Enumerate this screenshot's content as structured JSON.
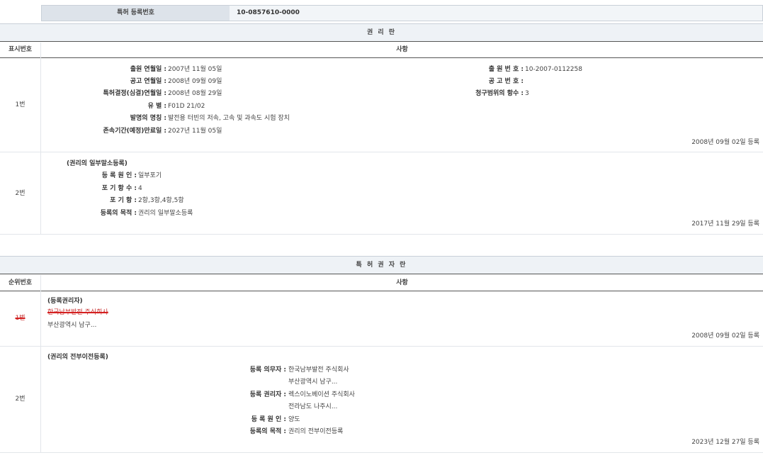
{
  "header": {
    "reg_label": "특허 등록번호",
    "reg_value": "10-0857610-0000"
  },
  "rights": {
    "title": "권 리 란",
    "col_num": "표시번호",
    "col_item": "사항",
    "row1": {
      "num": "1번",
      "left": [
        {
          "k": "출원 연월일 :",
          "v": "2007년 11월 05일"
        },
        {
          "k": "공고 연월일 :",
          "v": "2008년 09월 09일"
        },
        {
          "k": "특허결정(심결)연월일 :",
          "v": "2008년 08월 29일"
        },
        {
          "k": "유 별 :",
          "v": "F01D 21/02"
        },
        {
          "k": "발명의 명칭 :",
          "v": "발전용 터빈의 저속, 고속 및 과속도 시험 장치"
        },
        {
          "k": "존속기간(예정)만료일 :",
          "v": "2027년 11월 05일"
        }
      ],
      "right": [
        {
          "k": "출 원 번 호 :",
          "v": "10-2007-0112258"
        },
        {
          "k": "공 고 번 호 :",
          "v": ""
        },
        {
          "k": "청구범위의 항수 :",
          "v": "3"
        }
      ],
      "date": "2008년 09월 02일 등록"
    },
    "row2": {
      "num": "2번",
      "heading": "(권리의 일부말소등록)",
      "fields": [
        {
          "k": "등 록 원 인 :",
          "v": "일부포기"
        },
        {
          "k": "포 기 항 수 :",
          "v": "4"
        },
        {
          "k": "포 기 항 :",
          "v": "2항,3항,4항,5항"
        },
        {
          "k": "등록의 목적 :",
          "v": "권리의 일부말소등록"
        }
      ],
      "date": "2017년 11월 29일 등록"
    }
  },
  "holders": {
    "title": "특 허 권 자 란",
    "col_num": "순위번호",
    "col_item": "사항",
    "row1": {
      "num": "1번",
      "heading": "(등록권리자)",
      "name": "한국남부발전 주식회사",
      "addr": "부산광역시 남구...",
      "date": "2008년 09월 02일 등록"
    },
    "row2": {
      "num": "2번",
      "heading": "(권리의 전부이전등록)",
      "fields": [
        {
          "k": "등록 의무자 :",
          "v": "한국남부발전 주식회사"
        },
        {
          "k": "",
          "v": "부산광역시 남구..."
        },
        {
          "k": "등록 권리자 :",
          "v": "렉스이노베이션 주식회사"
        },
        {
          "k": "",
          "v": "전라남도 나주시..."
        },
        {
          "k": "등 록 원 인 :",
          "v": "양도"
        },
        {
          "k": "등록의 목적 :",
          "v": "권리의 전부이전등록"
        }
      ],
      "date": "2023년 12월 27일 등록"
    }
  }
}
